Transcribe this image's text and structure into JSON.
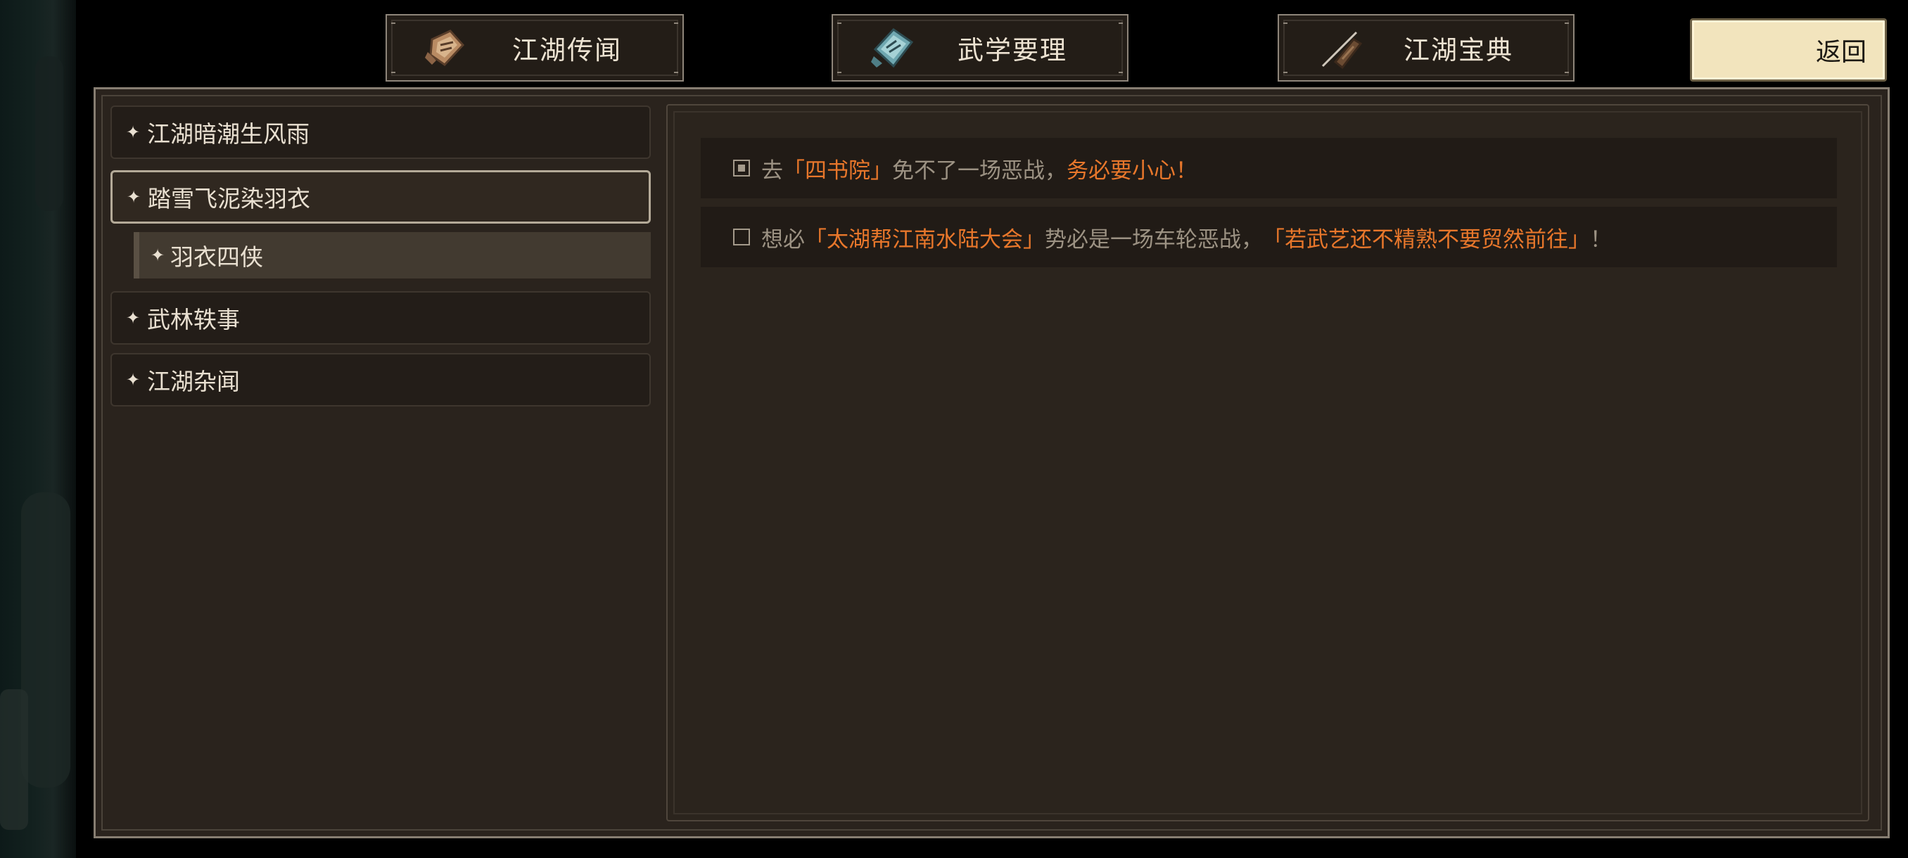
{
  "tabs": [
    {
      "label": "江湖传闻",
      "icon": "map-scroll-icon"
    },
    {
      "label": "武学要理",
      "icon": "martial-scroll-icon"
    },
    {
      "label": "江湖宝典",
      "icon": "bamboo-brush-icon"
    }
  ],
  "back_label": "返回",
  "categories": [
    {
      "label": "江湖暗潮生风雨",
      "selected": false
    },
    {
      "label": "踏雪飞泥染羽衣",
      "selected": true,
      "children": [
        {
          "label": "羽衣四侠"
        }
      ]
    },
    {
      "label": "武林轶事",
      "selected": false
    },
    {
      "label": "江湖杂闻",
      "selected": false
    }
  ],
  "quests": [
    {
      "completed": true,
      "parts": [
        "去",
        "「四书院」",
        "免不了一场恶战，",
        "务必要小心！"
      ]
    },
    {
      "completed": false,
      "parts": [
        "想必",
        "「太湖帮江南水陆大会」",
        "势必是一场车轮恶战，",
        "「若武艺还不精熟不要贸然前往」",
        "！"
      ]
    }
  ],
  "colors": {
    "highlight": "#e8772b",
    "text_dim": "#9c9283",
    "panel": "#2a231d",
    "back_button": "#f2e4bd"
  }
}
